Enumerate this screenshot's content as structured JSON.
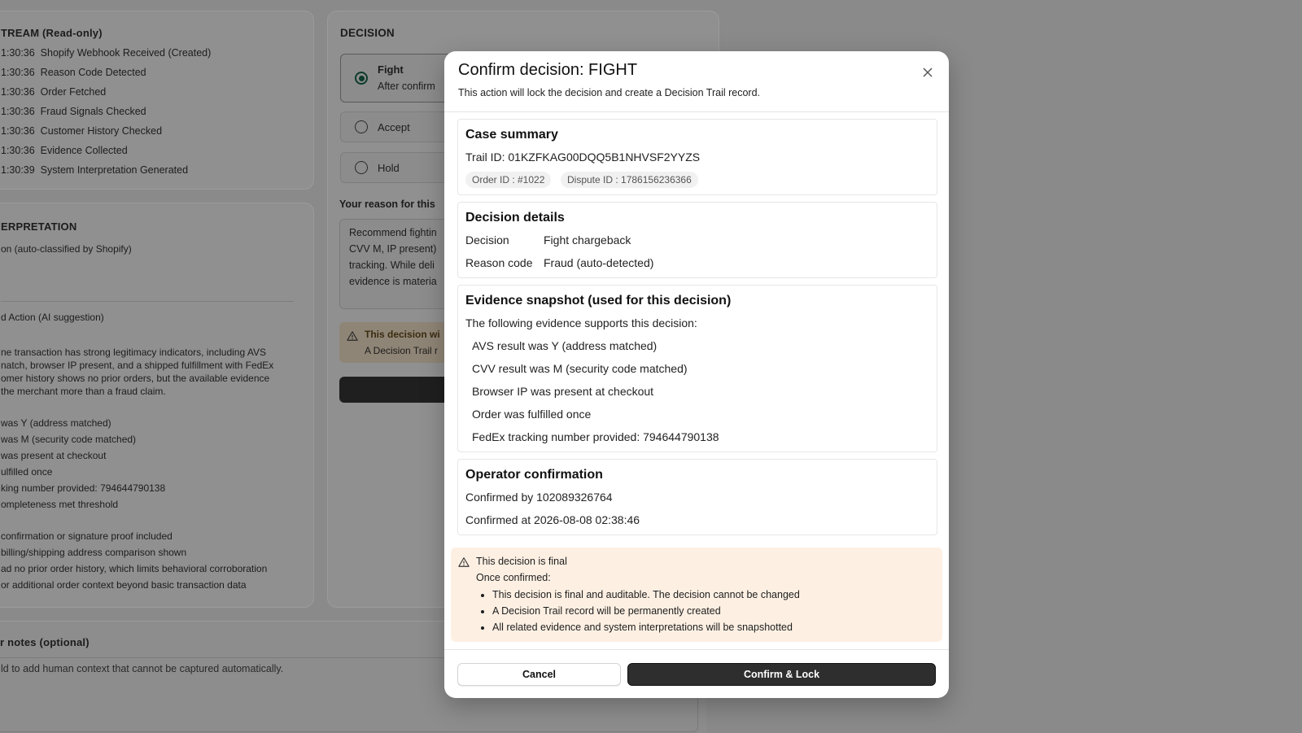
{
  "background": {
    "event_stream": {
      "title": "TREAM (Read-only)",
      "events": [
        {
          "time": "1:30:36",
          "label": "Shopify Webhook Received (Created)"
        },
        {
          "time": "1:30:36",
          "label": "Reason Code Detected"
        },
        {
          "time": "1:30:36",
          "label": "Order Fetched"
        },
        {
          "time": "1:30:36",
          "label": "Fraud Signals Checked"
        },
        {
          "time": "1:30:36",
          "label": "Customer History Checked"
        },
        {
          "time": "1:30:36",
          "label": "Evidence Collected"
        },
        {
          "time": "1:30:39",
          "label": "System Interpretation Generated"
        }
      ]
    },
    "interpretation": {
      "title": "ERPRETATION",
      "reason_line": "on (auto-classified by Shopify)",
      "action_label": "d Action (AI suggestion)",
      "summary_lines": [
        "ne transaction has strong legitimacy indicators, including AVS",
        "natch, browser IP present, and a shipped fulfillment with FedEx",
        "omer history shows no prior orders, but the available evidence",
        "the merchant more than a fraud claim."
      ],
      "evidence_lines": [
        "was Y (address matched)",
        "was M (security code matched)",
        "was present at checkout",
        "ulfilled once",
        "king number provided: 794644790138",
        "ompleteness met threshold"
      ],
      "gap_lines": [
        "confirmation or signature proof included",
        "billing/shipping address comparison shown",
        "ad no prior order history, which limits behavioral corroboration",
        "or additional order context beyond basic transaction data"
      ]
    },
    "notes": {
      "title": "r notes (optional)",
      "placeholder": "ld to add human context that cannot be captured automatically."
    },
    "decision_panel": {
      "title": "DECISION",
      "options": [
        {
          "label": "Fight",
          "sub": "After confirm",
          "selected": true
        },
        {
          "label": "Accept",
          "selected": false
        },
        {
          "label": "Hold",
          "selected": false
        }
      ],
      "reason_label": "Your reason for this",
      "reason_lines": [
        "Recommend fightin",
        "CVV M, IP present)",
        "tracking. While deli",
        "evidence is materia"
      ],
      "warn_title": "This decision wi",
      "warn_sub": "A Decision Trail r"
    }
  },
  "modal": {
    "title": "Confirm decision: FIGHT",
    "subtitle": "This action will lock the decision and create a Decision Trail record.",
    "case_summary": {
      "heading": "Case summary",
      "trail_id": "Trail ID: 01KZFKAG00DQQ5B1NHVSF2YYZS",
      "order_chip": "Order ID : #1022",
      "dispute_chip": "Dispute ID : 1786156236366"
    },
    "decision_details": {
      "heading": "Decision details",
      "decision_label": "Decision",
      "decision_value": "Fight chargeback",
      "reason_label": "Reason code",
      "reason_value": "Fraud (auto-detected)"
    },
    "evidence_snapshot": {
      "heading": "Evidence snapshot (used for this decision)",
      "intro": "The following evidence supports this decision:",
      "items": [
        "AVS result was Y (address matched)",
        "CVV result was M (security code matched)",
        "Browser IP was present at checkout",
        "Order was fulfilled once",
        "FedEx tracking number provided: 794644790138"
      ]
    },
    "operator_confirmation": {
      "heading": "Operator confirmation",
      "confirmed_by": "Confirmed by 102089326764",
      "confirmed_at": "Confirmed at 2026-08-08 02:38:46"
    },
    "final_warning": {
      "title": "This decision is final",
      "lead": "Once confirmed:",
      "bullets": [
        "This decision is final and auditable. The decision cannot be changed",
        "A Decision Trail record will be permanently created",
        "All related evidence and system interpretations will be snapshotted"
      ]
    },
    "cancel_label": "Cancel",
    "confirm_label": "Confirm & Lock"
  }
}
